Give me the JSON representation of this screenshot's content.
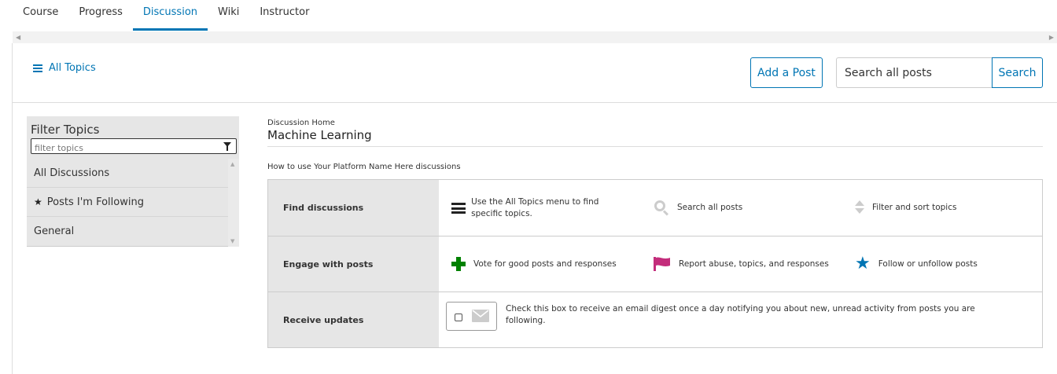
{
  "tabs": [
    {
      "label": "Course"
    },
    {
      "label": "Progress"
    },
    {
      "label": "Discussion",
      "active": true
    },
    {
      "label": "Wiki"
    },
    {
      "label": "Instructor"
    }
  ],
  "header": {
    "all_topics": "All Topics",
    "add_post": "Add a Post",
    "search_placeholder": "Search all posts",
    "search_button": "Search"
  },
  "filter": {
    "title": "Filter Topics",
    "placeholder": "filter topics",
    "topics": [
      {
        "label": "All Discussions"
      },
      {
        "label": "Posts I'm Following",
        "icon": "star-icon"
      },
      {
        "label": "General"
      }
    ]
  },
  "main": {
    "breadcrumb": "Discussion Home",
    "title": "Machine Learning",
    "howto": "How to use Your Platform Name Here discussions",
    "rows": [
      {
        "label": "Find discussions",
        "items": [
          {
            "icon": "menu-icon",
            "text": "Use the All Topics menu to find specific topics."
          },
          {
            "icon": "search-icon",
            "text": "Search all posts"
          },
          {
            "icon": "sort-icon",
            "text": "Filter and sort topics"
          }
        ]
      },
      {
        "label": "Engage with posts",
        "items": [
          {
            "icon": "plus-icon",
            "text": "Vote for good posts and responses"
          },
          {
            "icon": "flag-icon",
            "text": "Report abuse, topics, and responses"
          },
          {
            "icon": "star-icon",
            "text": "Follow or unfollow posts"
          }
        ]
      },
      {
        "label": "Receive updates",
        "digest_text": "Check this box to receive an email digest once a day notifying you about new, unread activity from posts you are following.",
        "digest_checked": false
      }
    ]
  },
  "colors": {
    "accent": "#0075b4",
    "vote_green": "#008100",
    "flag_pink": "#c32d7b",
    "panel_gray": "#e6e6e6"
  }
}
